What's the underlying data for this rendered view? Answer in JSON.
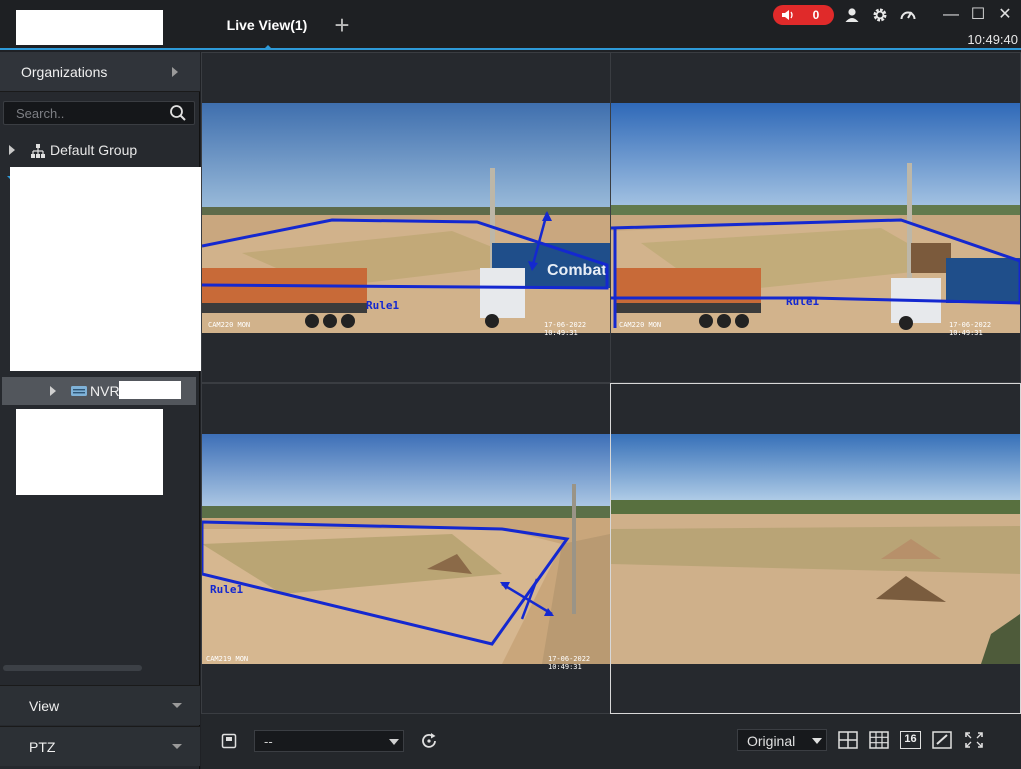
{
  "topbar": {
    "tab_label": "Live View(1)",
    "add_tab": "+",
    "alarm_count": "0",
    "clock": "10:49:40",
    "minimize": "—",
    "maximize": "☐",
    "close": "✕"
  },
  "sidebar": {
    "organizations": "Organizations",
    "search_placeholder": "Search..",
    "default_group": "Default Group",
    "nvr_label": "NVR",
    "view": "View",
    "ptz": "PTZ"
  },
  "cameras": [
    {
      "label": "CAM220 MON",
      "timestamp": "17-06-2022 10:49:31",
      "rule": "Rule1"
    },
    {
      "label": "CAM220 MON",
      "timestamp": "17-06-2022 10:49:31",
      "rule": "Rule1"
    },
    {
      "label": "CAM219 MON",
      "timestamp": "17-06-2022 10:49:31",
      "rule": "Rule1"
    },
    {
      "label": "",
      "timestamp": "",
      "rule": ""
    }
  ],
  "truck_text": "Combat",
  "bottombar": {
    "preset_value": "--",
    "scale_value": "Original",
    "layout_16": "16"
  },
  "colors": {
    "accent": "#2e9ad8",
    "alarm": "#e02a2a",
    "rule_line": "#1428d0"
  }
}
